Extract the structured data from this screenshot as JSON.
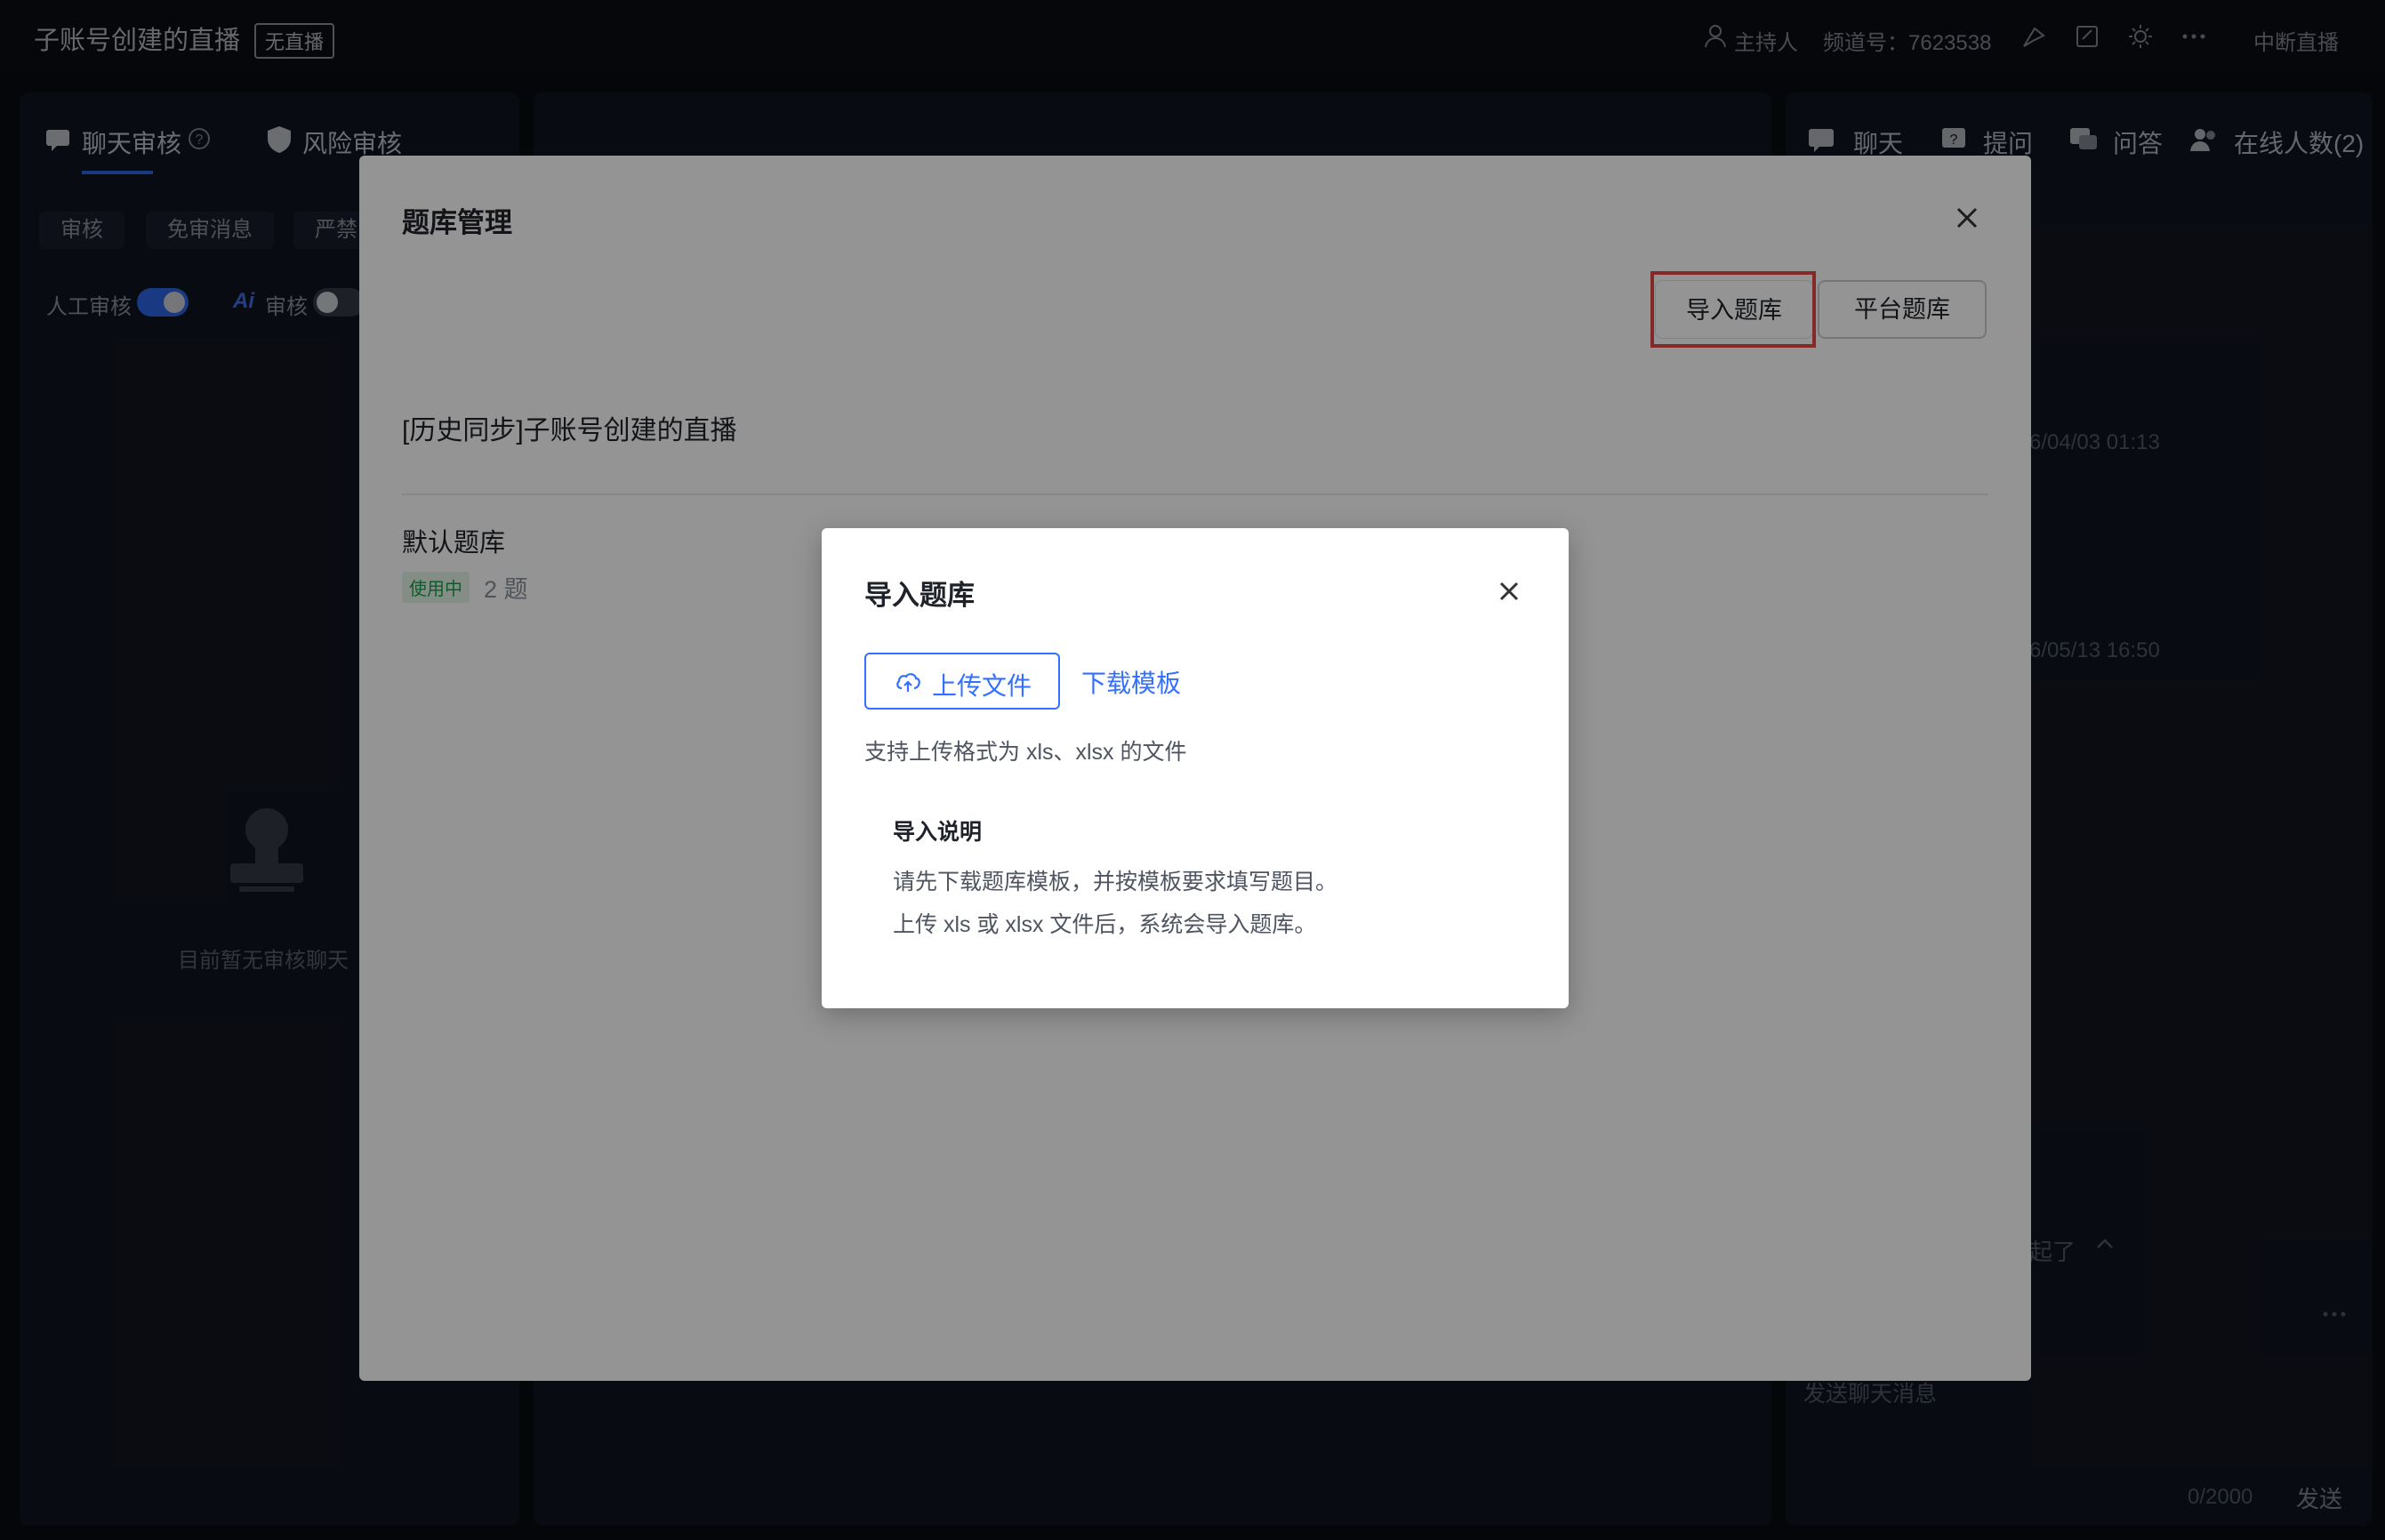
{
  "header": {
    "title": "子账号创建的直播",
    "live_status": "无直播",
    "role": "主持人",
    "channel": "频道号：7623538",
    "end_button": "中断直播"
  },
  "left_panel": {
    "tabs": [
      "聊天审核",
      "风险审核"
    ],
    "subtabs": [
      "审核",
      "免审消息",
      "严禁"
    ],
    "manual_review": "人工审核",
    "ai_review": "审核",
    "ai_prefix": "Ai",
    "empty_text": "目前暂无审核聊天"
  },
  "right_panel": {
    "tabs": [
      "聊天",
      "提问",
      "问答",
      "在线人数(2)"
    ],
    "timestamps": [
      "6/04/03 01:13",
      "6/05/13 16:50"
    ],
    "collapsed_hint": "起了",
    "chat_placeholder": "发送聊天消息",
    "counter": "0/2000",
    "send": "发送"
  },
  "bank_modal": {
    "title": "题库管理",
    "import_button": "导入题库",
    "platform_button": "平台题库",
    "bank_name": "[历史同步]子账号创建的直播",
    "default_bank": "默认题库",
    "status": "使用中",
    "count": "2 题"
  },
  "import_dialog": {
    "title": "导入题库",
    "upload_button": "上传文件",
    "download_link": "下载模板",
    "format_hint": "支持上传格式为 xls、xlsx 的文件",
    "notes_title": "导入说明",
    "notes": [
      "请先下载题库模板，并按模板要求填写题目。",
      "上传 xls 或 xlsx 文件后，系统会导入题库。"
    ]
  },
  "colors": {
    "accent": "#3370ff",
    "highlight": "#e54545",
    "status_green": "#1a9e4a"
  }
}
